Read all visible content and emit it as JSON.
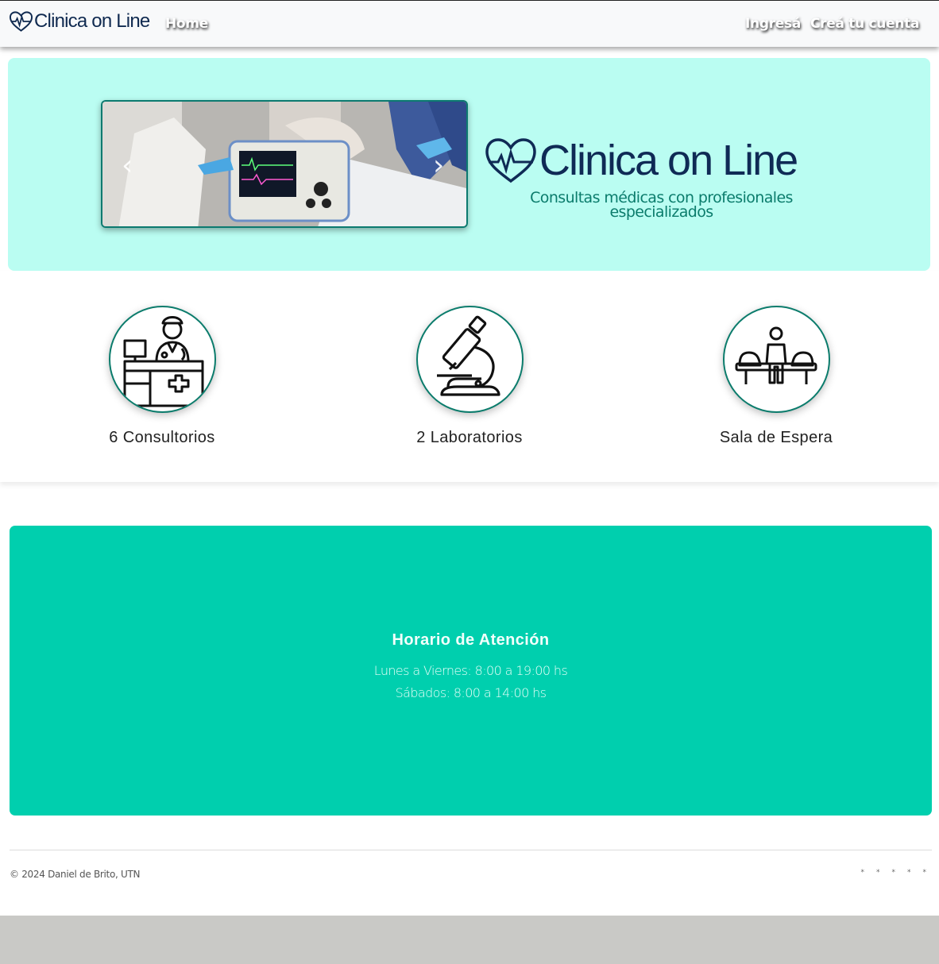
{
  "navbar": {
    "brand": "Clinica on Line",
    "home": "Home",
    "login": "Ingresá",
    "register": "Creá tu cuenta"
  },
  "hero": {
    "carousel_prev": "‹",
    "carousel_next": "›",
    "title": "Clinica on Line",
    "subtitle": "Consultas médicas con profesionales especializados"
  },
  "features": [
    {
      "label": "6 Consultorios",
      "icon": "doctor-desk-icon"
    },
    {
      "label": "2 Laboratorios",
      "icon": "microscope-icon"
    },
    {
      "label": "Sala de Espera",
      "icon": "waiting-room-icon"
    }
  ],
  "schedule": {
    "title": "Horario de Atención",
    "weekdays": "Lunes a Viernes: 8:00 a 19:00 hs",
    "saturday": "Sábados: 8:00 a 14:00 hs"
  },
  "footer": {
    "copyright": "© 2024 Daniel de Brito, UTN",
    "social": [
      "*",
      "*",
      "*",
      "*",
      "*"
    ]
  },
  "colors": {
    "brand_navy": "#0f2a55",
    "hero_bg": "#bafdf2",
    "accent_teal": "#0b7c6c",
    "schedule_bg": "#00cfae"
  }
}
